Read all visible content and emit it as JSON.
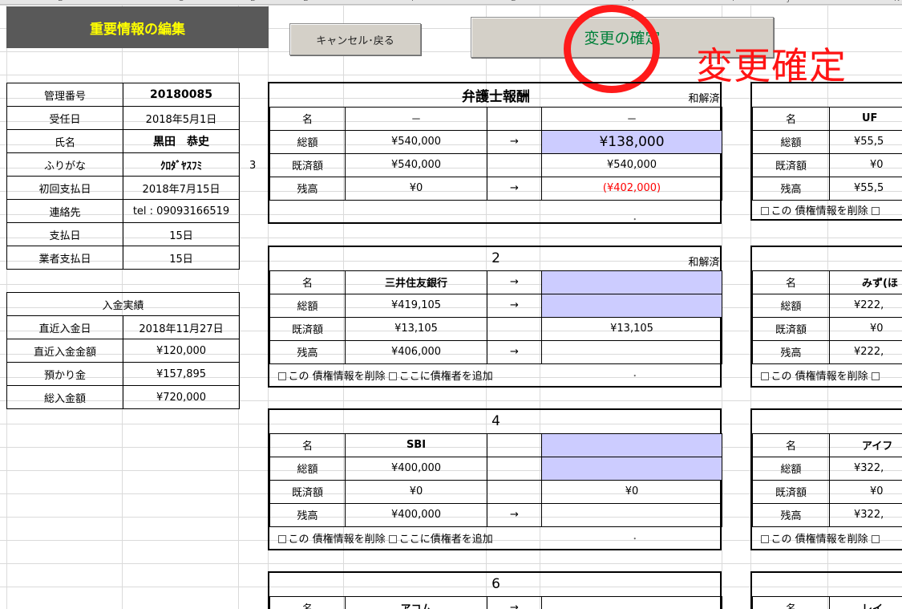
{
  "sheet": {
    "columns": [
      "B",
      "C",
      "D",
      "E",
      "F",
      "G",
      "H",
      "I",
      "J",
      "K"
    ]
  },
  "header": {
    "title": "重要情報の編集",
    "cancel_label": "キャンセル･戻る",
    "confirm_label": "変更の確定",
    "annotation": "変更確定",
    "annotation_color": "#ff1414",
    "confirm_text_color": "#00803a"
  },
  "client": {
    "rows": [
      {
        "label": "管理番号",
        "value": "20180085"
      },
      {
        "label": "受任日",
        "value": "2018年5月1日"
      },
      {
        "label": "氏名",
        "value": "黒田　恭史"
      },
      {
        "label": "ふりがな",
        "value": "ｸﾛﾀﾞﾔｽﾌﾐ"
      },
      {
        "label": "初回支払日",
        "value": "2018年7月15日"
      },
      {
        "label": "連絡先",
        "value": "tel : 09093166519"
      },
      {
        "label": "支払日",
        "value": "15日"
      },
      {
        "label": "業者支払日",
        "value": "15日"
      }
    ],
    "payments_heading": "入金実績",
    "payments": [
      {
        "label": "直近入金日",
        "value": "2018年11月27日"
      },
      {
        "label": "直近入金金額",
        "value": "¥120,000"
      },
      {
        "label": "預かり金",
        "value": "¥157,895"
      },
      {
        "label": "総入金額",
        "value": "¥720,000"
      }
    ],
    "side_number": "3"
  },
  "labels": {
    "name": "名",
    "total": "総額",
    "paid": "既済額",
    "balance": "残高",
    "arrow": "→",
    "delete_checkbox": "この 債権情報を削除",
    "add_checkbox": "ここに債権者を追加",
    "dot": "･"
  },
  "cards": [
    {
      "title": "弁護士報酬",
      "status": "和解済",
      "name": "－",
      "new_name": "－",
      "total": "¥540,000",
      "new_total": "¥138,000",
      "paid": "¥540,000",
      "new_paid": "¥540,000",
      "balance": "¥0",
      "new_balance": "(¥402,000)"
    },
    {
      "title": "2",
      "status": "和解済",
      "name": "三井住友銀行",
      "new_name": "",
      "total": "¥419,105",
      "new_total": "",
      "paid": "¥13,105",
      "new_paid": "¥13,105",
      "balance": "¥406,000",
      "new_balance": ""
    },
    {
      "title": "4",
      "status": "",
      "name": "SBI",
      "new_name": "",
      "total": "¥400,000",
      "new_total": "",
      "paid": "¥0",
      "new_paid": "¥0",
      "balance": "¥400,000",
      "new_balance": ""
    },
    {
      "title": "6",
      "name": "アコム"
    }
  ],
  "right_cards": [
    {
      "name": "UF",
      "total": "¥55,5",
      "paid": "¥0",
      "balance": "¥55,5"
    },
    {
      "name": "みず(ほ",
      "total": "¥222,",
      "paid": "¥0",
      "balance": "¥222,"
    },
    {
      "name": "アイフ",
      "total": "¥322,",
      "paid": "¥0",
      "balance": "¥322,"
    },
    {
      "name": "レイ"
    }
  ]
}
